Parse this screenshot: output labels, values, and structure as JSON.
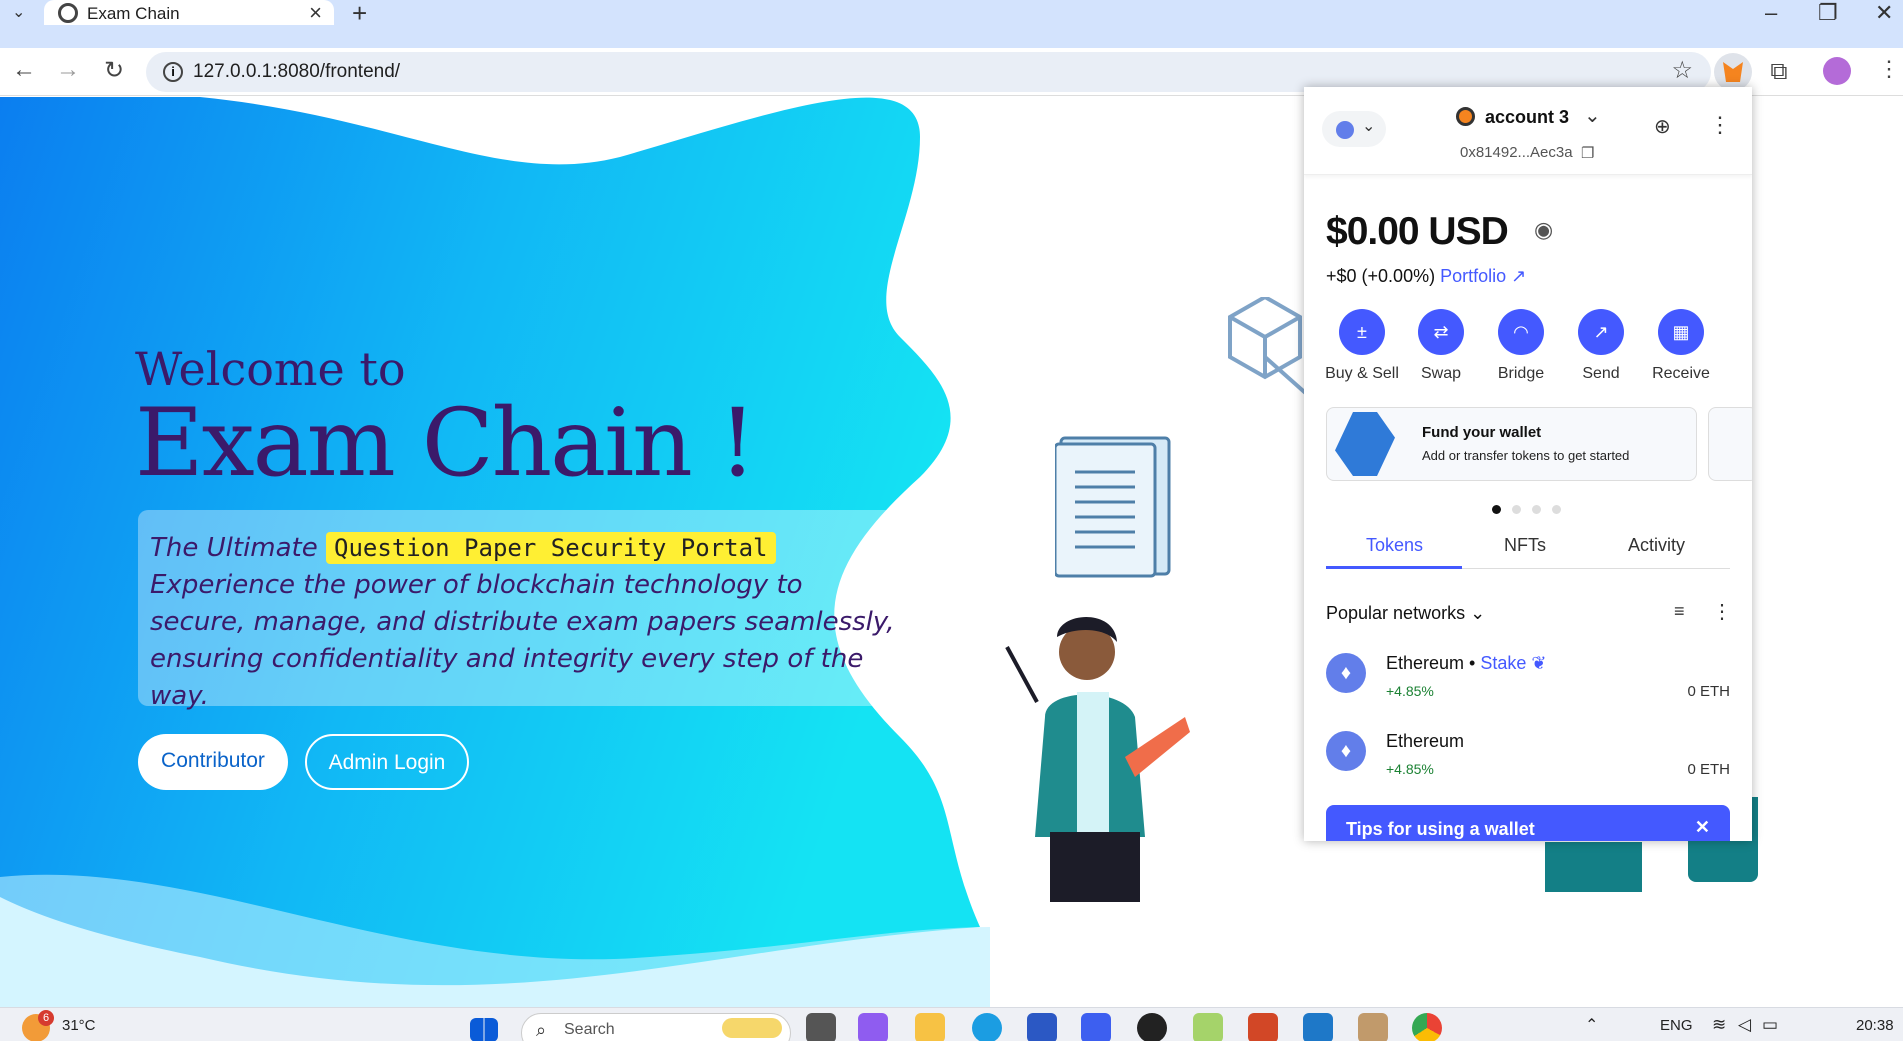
{
  "browser": {
    "tab_title": "Exam Chain",
    "url": "127.0.0.1:8080/frontend/",
    "new_tab": "+",
    "window_controls": [
      "–",
      "❐",
      "✕"
    ]
  },
  "hero": {
    "welcome": "Welcome to",
    "title": "Exam Chain !",
    "tagline_prefix": "The Ultimate",
    "tagline_highlight": "Question Paper Security Portal",
    "description": "Experience the power of blockchain technology to secure, manage, and distribute exam papers seamlessly, ensuring confidentiality and integrity every step of the way.",
    "buttons": {
      "contributor": "Contributor",
      "admin": "Admin Login"
    }
  },
  "wallet": {
    "account_name": "account 3",
    "address": "0x81492...Aec3a",
    "balance": "$0.00 USD",
    "change": "+$0 (+0.00%)",
    "portfolio": "Portfolio",
    "actions": [
      {
        "label": "Buy & Sell",
        "icon": "±"
      },
      {
        "label": "Swap",
        "icon": "⇄"
      },
      {
        "label": "Bridge",
        "icon": "◠"
      },
      {
        "label": "Send",
        "icon": "↗"
      },
      {
        "label": "Receive",
        "icon": "▦"
      }
    ],
    "card": {
      "title": "Fund your wallet",
      "subtitle": "Add or transfer tokens to get started"
    },
    "tabs": [
      "Tokens",
      "NFTs",
      "Activity"
    ],
    "networks_label": "Popular networks",
    "tokens": [
      {
        "name": "Ethereum",
        "stake": "Stake",
        "change": "+4.85%",
        "balance": "0 ETH"
      },
      {
        "name": "Ethereum",
        "change": "+4.85%",
        "balance": "0 ETH"
      }
    ],
    "tips": "Tips for using a wallet"
  },
  "taskbar": {
    "weather_badge": "6",
    "temperature": "31°C",
    "search": "Search",
    "language": "ENG",
    "time": "20:38"
  },
  "colors": {
    "accent": "#4459ff",
    "hero_text": "#3b1a6a",
    "highlight": "#ffef33"
  }
}
